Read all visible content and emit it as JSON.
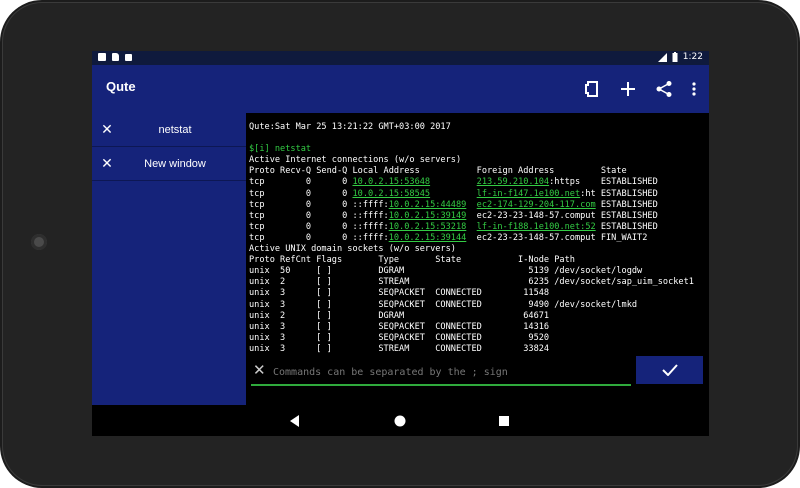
{
  "status_bar": {
    "time": "1:22"
  },
  "app": {
    "title": "Qute"
  },
  "tabs": [
    {
      "label": "netstat"
    },
    {
      "label": "New window"
    }
  ],
  "terminal": {
    "lines": [
      {
        "parts": [
          {
            "t": "Qute:Sat Mar 25 13:21:22 GMT+03:00 2017",
            "c": ""
          }
        ]
      },
      {
        "parts": [
          {
            "t": "",
            "c": ""
          }
        ]
      },
      {
        "parts": [
          {
            "t": "$[i] netstat",
            "c": "green"
          }
        ]
      },
      {
        "parts": [
          {
            "t": "Active Internet connections (w/o servers)",
            "c": ""
          }
        ]
      },
      {
        "parts": [
          {
            "t": "Proto Recv-Q Send-Q Local Address           Foreign Address         State",
            "c": ""
          }
        ]
      },
      {
        "parts": [
          {
            "t": "tcp        0      0 ",
            "c": ""
          },
          {
            "t": "10.0.2.15:53648",
            "c": "link"
          },
          {
            "t": "         ",
            "c": ""
          },
          {
            "t": "213.59.210.104",
            "c": "link"
          },
          {
            "t": ":https    ESTABLISHED",
            "c": ""
          }
        ]
      },
      {
        "parts": [
          {
            "t": "tcp        0      0 ",
            "c": ""
          },
          {
            "t": "10.0.2.15:58545",
            "c": "link"
          },
          {
            "t": "         ",
            "c": ""
          },
          {
            "t": "lf-in-f147.1e100.net",
            "c": "link"
          },
          {
            "t": ":ht ESTABLISHED",
            "c": ""
          }
        ]
      },
      {
        "parts": [
          {
            "t": "tcp        0      0 ::ffff:",
            "c": ""
          },
          {
            "t": "10.0.2.15:44489",
            "c": "link"
          },
          {
            "t": "  ",
            "c": ""
          },
          {
            "t": "ec2-174-129-204-117.com",
            "c": "link"
          },
          {
            "t": " ESTABLISHED",
            "c": ""
          }
        ]
      },
      {
        "parts": [
          {
            "t": "tcp        0      0 ::ffff:",
            "c": ""
          },
          {
            "t": "10.0.2.15:39149",
            "c": "link"
          },
          {
            "t": "  ec2-23-23-148-57.comput ESTABLISHED",
            "c": ""
          }
        ]
      },
      {
        "parts": [
          {
            "t": "tcp        0      0 ::ffff:",
            "c": ""
          },
          {
            "t": "10.0.2.15:53218",
            "c": "link"
          },
          {
            "t": "  ",
            "c": ""
          },
          {
            "t": "lf-in-f188.1e100.net:52",
            "c": "link"
          },
          {
            "t": " ESTABLISHED",
            "c": ""
          }
        ]
      },
      {
        "parts": [
          {
            "t": "tcp        0      0 ::ffff:",
            "c": ""
          },
          {
            "t": "10.0.2.15:39144",
            "c": "link"
          },
          {
            "t": "  ec2-23-23-148-57.comput FIN_WAIT2",
            "c": ""
          }
        ]
      },
      {
        "parts": [
          {
            "t": "Active UNIX domain sockets (w/o servers)",
            "c": ""
          }
        ]
      },
      {
        "parts": [
          {
            "t": "Proto RefCnt Flags       Type       State           I-Node Path",
            "c": ""
          }
        ]
      },
      {
        "parts": [
          {
            "t": "unix  50     [ ]         DGRAM                        5139 /dev/socket/logdw",
            "c": ""
          }
        ]
      },
      {
        "parts": [
          {
            "t": "unix  2      [ ]         STREAM                       6235 /dev/socket/sap_uim_socket1",
            "c": ""
          }
        ]
      },
      {
        "parts": [
          {
            "t": "unix  3      [ ]         SEQPACKET  CONNECTED        11548",
            "c": ""
          }
        ]
      },
      {
        "parts": [
          {
            "t": "unix  3      [ ]         SEQPACKET  CONNECTED         9490 /dev/socket/lmkd",
            "c": ""
          }
        ]
      },
      {
        "parts": [
          {
            "t": "unix  2      [ ]         DGRAM                       64671",
            "c": ""
          }
        ]
      },
      {
        "parts": [
          {
            "t": "unix  3      [ ]         SEQPACKET  CONNECTED        14316",
            "c": ""
          }
        ]
      },
      {
        "parts": [
          {
            "t": "unix  3      [ ]         SEQPACKET  CONNECTED         9520",
            "c": ""
          }
        ]
      },
      {
        "parts": [
          {
            "t": "unix  3      [ ]         STREAM     CONNECTED        33824",
            "c": ""
          }
        ]
      }
    ]
  },
  "command": {
    "placeholder": "Commands can be separated by the ; sign",
    "value": ""
  },
  "colors": {
    "accent": "#15237a",
    "status": "#0f1a3d",
    "terminal_green": "#33cc44"
  },
  "icons": {
    "toolbar": [
      "windows-icon",
      "add-icon",
      "share-icon",
      "overflow-menu-icon"
    ],
    "nav": [
      "back-icon",
      "home-icon",
      "recents-icon"
    ]
  }
}
